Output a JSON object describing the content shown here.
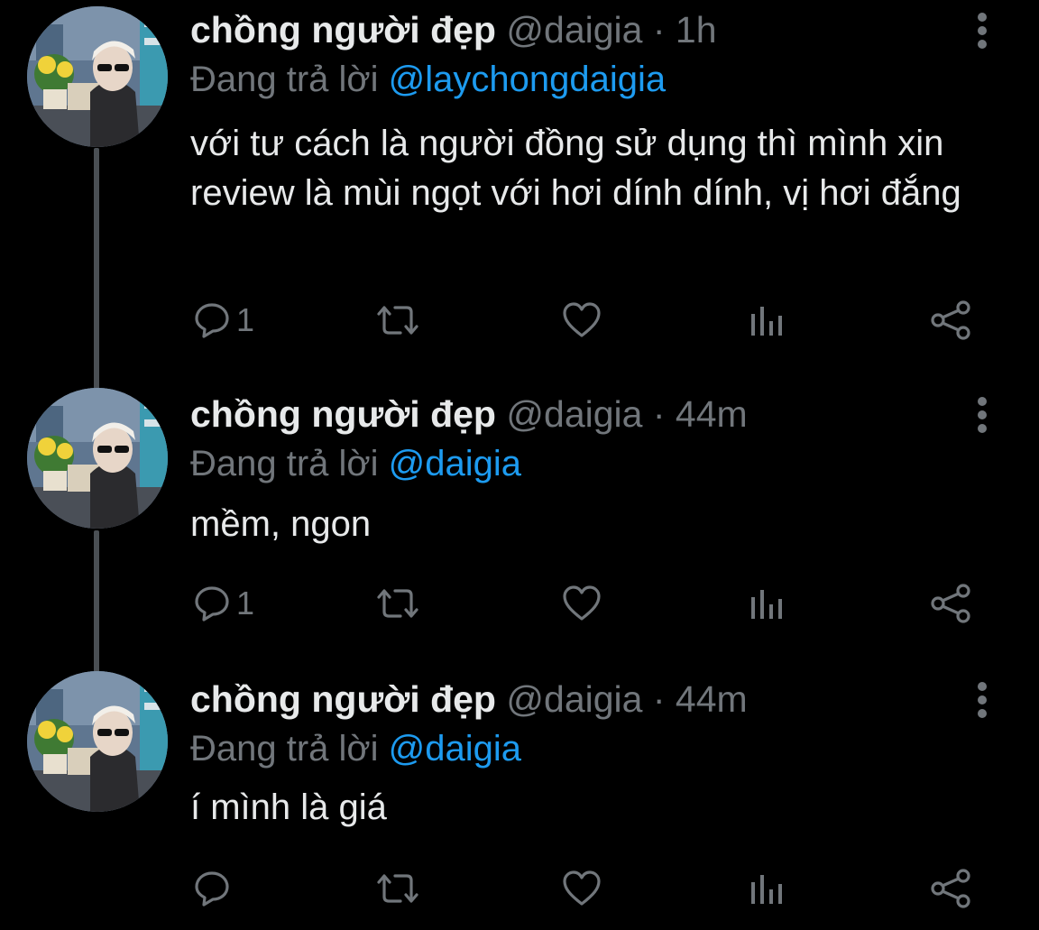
{
  "colors": {
    "background": "#000000",
    "text_primary": "#e7e9ea",
    "text_secondary": "#71767b",
    "mention": "#1d9bf0",
    "thread_line": "#4a4f54"
  },
  "tweets": [
    {
      "display_name": "chồng người đẹp",
      "handle": "@daigia",
      "separator": "·",
      "time": "1h",
      "reply_prefix": "Đang trả lời",
      "reply_to": "@laychongdaigia",
      "text": "với tư cách là người đồng sử dụng thì mình xin review là mùi ngọt với hơi dính dính, vị hơi đắng",
      "actions": {
        "reply_icon": "reply-icon",
        "reply_count": "1",
        "retweet_icon": "retweet-icon",
        "like_icon": "heart-icon",
        "views_icon": "analytics-icon",
        "share_icon": "share-icon"
      }
    },
    {
      "display_name": "chồng người đẹp",
      "handle": "@daigia",
      "separator": "·",
      "time": "44m",
      "reply_prefix": "Đang trả lời",
      "reply_to": "@daigia",
      "text": "mềm, ngon",
      "actions": {
        "reply_icon": "reply-icon",
        "reply_count": "1",
        "retweet_icon": "retweet-icon",
        "like_icon": "heart-icon",
        "views_icon": "analytics-icon",
        "share_icon": "share-icon"
      }
    },
    {
      "display_name": "chồng người đẹp",
      "handle": "@daigia",
      "separator": "·",
      "time": "44m",
      "reply_prefix": "Đang trả lời",
      "reply_to": "@daigia",
      "text": "í mình là giá",
      "actions": {
        "reply_icon": "reply-icon",
        "reply_count": "",
        "retweet_icon": "retweet-icon",
        "like_icon": "heart-icon",
        "views_icon": "analytics-icon",
        "share_icon": "share-icon"
      }
    }
  ]
}
